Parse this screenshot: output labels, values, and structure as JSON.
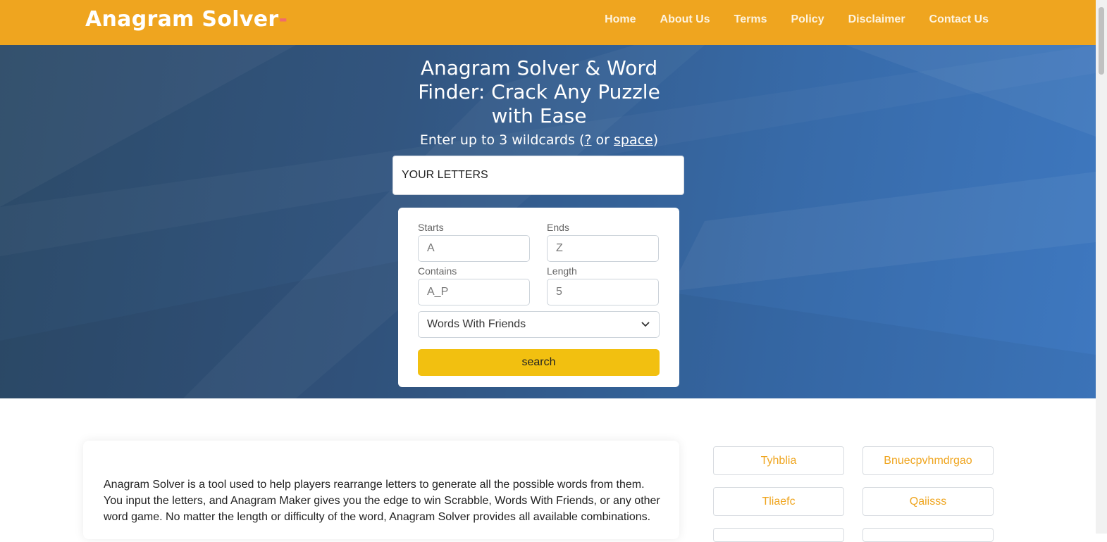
{
  "header": {
    "logo": "Anagram Solver",
    "logo_dash": "-",
    "nav": [
      "Home",
      "About Us",
      "Terms",
      "Policy",
      "Disclaimer",
      "Contact Us"
    ]
  },
  "hero": {
    "title": "Anagram Solver & Word Finder: Crack Any Puzzle with Ease",
    "sub_prefix": "Enter up to 3 wildcards (",
    "sub_q": "?",
    "sub_or": " or ",
    "sub_space": "space",
    "sub_suffix": ")",
    "letters_placeholder": "YOUR LETTERS"
  },
  "filters": {
    "starts_label": "Starts",
    "starts_placeholder": "A",
    "ends_label": "Ends",
    "ends_placeholder": "Z",
    "contains_label": "Contains",
    "contains_placeholder": "A_P",
    "length_label": "Length",
    "length_placeholder": "5",
    "dictionary_selected": "Words With Friends",
    "search_label": "search"
  },
  "article": {
    "text": "Anagram Solver is a tool used to help players rearrange letters to generate all the possible words from them. You input the letters, and Anagram Maker gives you the edge to win Scrabble, Words With Friends, or any other word game. No matter the length or difficulty of the word, Anagram Solver provides all available combinations."
  },
  "chips": [
    "Tyhblia",
    "Bnuecpvhmdrgao",
    "Tliaefc",
    "Qaiisss"
  ],
  "colors": {
    "header_bg": "#efa51f",
    "button_bg": "#f2c010",
    "chip_text": "#efa51f"
  }
}
